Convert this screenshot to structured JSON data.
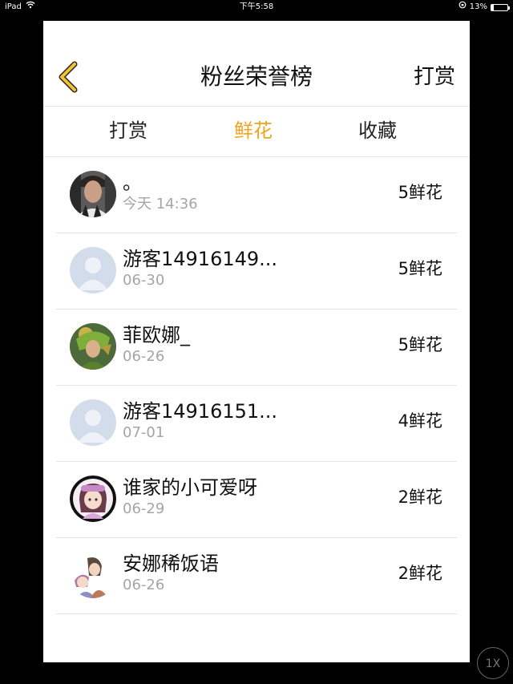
{
  "status_bar": {
    "device": "iPad",
    "time": "下午5:58",
    "battery": "13%",
    "battery_level": 0.13
  },
  "header": {
    "title": "粉丝荣誉榜",
    "action_label": "打赏",
    "back_icon": "chevron-left-icon",
    "back_color": "#f2c230"
  },
  "tabs": [
    {
      "label": "打赏",
      "active": false
    },
    {
      "label": "鲜花",
      "active": true
    },
    {
      "label": "收藏",
      "active": false
    }
  ],
  "accent_color": "#f0a31e",
  "fans": [
    {
      "name": "。",
      "date": "今天 14:36",
      "count": "5鲜花",
      "avatar": "photo-avatar"
    },
    {
      "name": "游客14916149...",
      "date": "06-30",
      "count": "5鲜花",
      "avatar": "default-avatar"
    },
    {
      "name": "菲欧娜_",
      "date": "06-26",
      "count": "5鲜花",
      "avatar": "game-character-avatar"
    },
    {
      "name": "游客14916151...",
      "date": "07-01",
      "count": "4鲜花",
      "avatar": "default-avatar"
    },
    {
      "name": "谁家的小可爱呀",
      "date": "06-29",
      "count": "2鲜花",
      "avatar": "anime-avatar"
    },
    {
      "name": "安娜稀饭语",
      "date": "06-26",
      "count": "2鲜花",
      "avatar": "anime-couple-avatar"
    }
  ],
  "playback": {
    "speed_label": "1X"
  }
}
